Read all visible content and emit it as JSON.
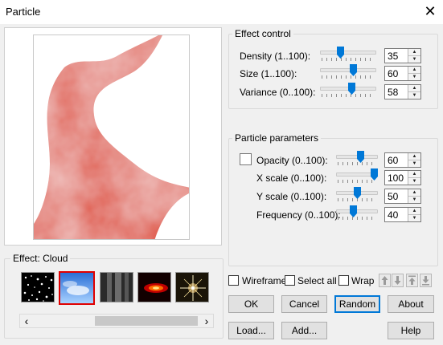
{
  "window": {
    "title": "Particle",
    "close_glyph": "✕"
  },
  "effect_control": {
    "title": "Effect control",
    "rows": [
      {
        "label": "Density (1..100):",
        "value": "35",
        "fraction": 0.35
      },
      {
        "label": "Size (1..100):",
        "value": "60",
        "fraction": 0.6
      },
      {
        "label": "Variance (0..100):",
        "value": "58",
        "fraction": 0.58
      }
    ]
  },
  "particle_parameters": {
    "title": "Particle parameters",
    "rows": [
      {
        "label": "Opacity (0..100):",
        "value": "60",
        "fraction": 0.6,
        "has_checkbox": true
      },
      {
        "label": "X scale (0..100):",
        "value": "100",
        "fraction": 1.0
      },
      {
        "label": "Y scale (0..100):",
        "value": "50",
        "fraction": 0.5
      },
      {
        "label": "Frequency (0..100):",
        "value": "40",
        "fraction": 0.4
      }
    ]
  },
  "effect_section": {
    "title": "Effect: Cloud",
    "selected_index": 1,
    "thumbnails": [
      "stars-thumb",
      "cloud-thumb",
      "smoke-thumb",
      "fire-thumb",
      "sparkle-thumb"
    ]
  },
  "options": {
    "wireframe": "Wireframe",
    "select_all": "Select all",
    "wrap": "Wrap",
    "wireframe_checked": false,
    "select_all_checked": false,
    "wrap_checked": false
  },
  "buttons": {
    "ok": "OK",
    "cancel": "Cancel",
    "random": "Random",
    "about": "About",
    "load": "Load...",
    "add": "Add...",
    "help": "Help"
  },
  "icons": {
    "move_up": "↑",
    "move_down": "↓",
    "move_top": "⤒",
    "move_bottom": "⤓",
    "scroll_left": "‹",
    "scroll_right": "›"
  },
  "colors": {
    "accent": "#0078d7",
    "selected_border": "#e00000",
    "preview_red": "#e05a48"
  }
}
